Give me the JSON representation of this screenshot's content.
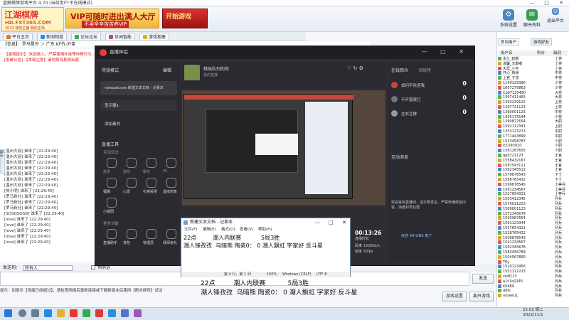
{
  "client": {
    "title": "蓝鲸棋牌游戏平台 4.70 (当前用户:不在线模式)",
    "window_controls": "— □ ✕",
    "logo": {
      "line1": "江湖棋牌",
      "line2": "HD.FXT365.COM",
      "line3": "2013 我的主播 我的主场"
    },
    "vip_banner": {
      "line1": "VIP可随时进出满人大厅",
      "line2": "不用辛辛苦苦养VIP"
    },
    "ad_banner": "开始游戏",
    "top_buttons": [
      {
        "label": "系统设置",
        "icon": "gear-icon"
      },
      {
        "label": "聊天有料",
        "icon": "chat-icon"
      },
      {
        "label": "个人中心",
        "icon": "user-icon"
      },
      {
        "label": "退出平台",
        "icon": "exit-icon"
      }
    ],
    "tabs": [
      "平台主页",
      "新闻频道",
      "论坛论坛",
      "体闲智能",
      "游戏相册"
    ],
    "address": "【信息】：罗马星外 ＞ 广东 KF竹-外佬",
    "chat_lines": [
      {
        "text": "【游戏提示】 欢迎进入，严禁使用外挂等作弊行为……",
        "sys": true
      },
      {
        "text": "[系统公告] 【本局注意】请勿辱骂其他玩家",
        "sys": true
      },
      {
        "text": "[温州大叔] 谁来了 [22:29:40]",
        "sys": false
      },
      {
        "text": "[温州大叔] 谁来了 [22:29:40]",
        "sys": false
      },
      {
        "text": "[温州大叔] 谁来了 [22:29:40]",
        "sys": false
      },
      {
        "text": "[温州大叔] 谁来了 [22:29:40]",
        "sys": false
      },
      {
        "text": "[温州大叔] 谁来了 [22:29:40]",
        "sys": false
      },
      {
        "text": "[温州大叔] 谁来了 [22:29:40]",
        "sys": false
      },
      {
        "text": "[温州大叔] 谁来了 [22:29:40]",
        "sys": false
      },
      {
        "text": "[陈小明] 谁来了 [22:29:40]",
        "sys": false
      },
      {
        "text": "[罗马新社] 谁来了 [22:29:40]",
        "sys": false
      },
      {
        "text": "[罗马新社] 谁来了 [22:29:40]",
        "sys": false
      },
      {
        "text": "[罗马新社] 谁来了 [22:29:40]",
        "sys": false
      },
      {
        "text": "[SOSOSOSO] 谁来了 [22:29:40]",
        "sys": false
      },
      {
        "text": "[love] 谁来了 [22:29:40]",
        "sys": false
      },
      {
        "text": "[love] 谁来了 [22:29:40]",
        "sys": false
      },
      {
        "text": "[love] 谁来了 [22:29:40]",
        "sys": false
      },
      {
        "text": "[love] 谁来了 [22:29:40]",
        "sys": false
      },
      {
        "text": "[love] 谁来了 [22:29:40]",
        "sys": false
      }
    ],
    "left_edge": "聊天",
    "input_label": "发送到：",
    "input_value": "所有人",
    "checkbox_label": "悄悄话",
    "send_button": "发送",
    "hint_text": "提示：如提示【连接已经超过】，请检查网络后重新连接或下载新版本后使用【断点续传】试试",
    "bottom_buttons": [
      "游戏设置",
      "离开游戏"
    ],
    "right_tabs": [
      "房间用户",
      "游戏好友"
    ],
    "right_header": [
      "用户名",
      "积分",
      "级别"
    ],
    "users": [
      {
        "name": "永久_欧鹏",
        "lvl": "上将"
      },
      {
        "name": "温馨_无聊者",
        "lvl": "上将"
      },
      {
        "name": "天涯_小牛",
        "lvl": "上将"
      },
      {
        "name": "开心_随缘",
        "lvl": "中将"
      },
      {
        "name": "上官_子龙",
        "lvl": "中将"
      },
      {
        "name": "1140129390",
        "lvl": "少将"
      },
      {
        "name": "1007279863",
        "lvl": "少将"
      },
      {
        "name": "Cd07120450",
        "lvl": "大校"
      },
      {
        "name": "1397411465",
        "lvl": "大校"
      },
      {
        "name": "1393229122",
        "lvl": "上校"
      },
      {
        "name": "1397721123",
        "lvl": "上校"
      },
      {
        "name": "1390001123",
        "lvl": "中校"
      },
      {
        "name": "1305175544",
        "lvl": "少校"
      },
      {
        "name": "1390827654",
        "lvl": "大尉"
      },
      {
        "name": "1592112341",
        "lvl": "上尉"
      },
      {
        "name": "1353123213",
        "lvl": "中尉"
      },
      {
        "name": "1771443899",
        "lvl": "中尉"
      },
      {
        "name": "1533458787",
        "lvl": "少尉"
      },
      {
        "name": "lc1093910",
        "lvl": "少尉"
      },
      {
        "name": "1581287655",
        "lvl": "少尉"
      },
      {
        "name": "qq0721123",
        "lvl": "士官"
      },
      {
        "name": "1558432167",
        "lvl": "士官"
      },
      {
        "name": "1597543111",
        "lvl": "士官"
      },
      {
        "name": "1562345512",
        "lvl": "士官"
      },
      {
        "name": "1579876543",
        "lvl": "下士"
      },
      {
        "name": "1588765432",
        "lvl": "下士"
      },
      {
        "name": "1599876545",
        "lvl": "上等兵"
      },
      {
        "name": "1561234567",
        "lvl": "上等兵"
      },
      {
        "name": "1527654321",
        "lvl": "上等兵"
      },
      {
        "name": "1503412345",
        "lvl": "列兵"
      },
      {
        "name": "1570011223",
        "lvl": "列兵"
      },
      {
        "name": "1589001123",
        "lvl": "列兵"
      },
      {
        "name": "1572345678",
        "lvl": "列兵"
      },
      {
        "name": "1530987654",
        "lvl": "列兵"
      },
      {
        "name": "1591123344",
        "lvl": "列兵"
      },
      {
        "name": "1557654321",
        "lvl": "列兵"
      },
      {
        "name": "1528765432",
        "lvl": "列兵"
      },
      {
        "name": "1509876543",
        "lvl": "列兵"
      },
      {
        "name": "1541234567",
        "lvl": "列兵"
      },
      {
        "name": "1562345678",
        "lvl": "列兵"
      },
      {
        "name": "1583456789",
        "lvl": "列兵"
      },
      {
        "name": "1504567890",
        "lvl": "列兵"
      },
      {
        "name": "Tfly",
        "lvl": "列兵"
      },
      {
        "name": "1520123456",
        "lvl": "列兵"
      },
      {
        "name": "1551112223",
        "lvl": "列兵"
      },
      {
        "name": "zsdf123",
        "lvl": "列兵"
      },
      {
        "name": "a1c1q1245",
        "lvl": "列兵"
      },
      {
        "name": "KKKKK",
        "lvl": "列兵"
      },
      {
        "name": "ddlk",
        "lvl": "列兵"
      },
      {
        "name": "noseeu1",
        "lvl": "列兵"
      }
    ]
  },
  "obs": {
    "title": "直播伴侣",
    "window_controls": "— □ ✕",
    "scene_mode": "常规模式",
    "scene_edit": "编辑",
    "sources": [
      {
        "label": "notepad.exe 新建文本文档 - 记事本"
      },
      {
        "label": "显示器1"
      }
    ],
    "add_source": "添加素材",
    "stream_title": "棋局队列的你",
    "stream_sub": "我的直播",
    "room_tab": "直播间",
    "tools_header": "直播工具",
    "interact_header": "互动玩法",
    "tools": [
      "投票",
      "连线",
      "聊天",
      "PK",
      "福袋",
      "心愿",
      "礼物投票",
      "虚拟形象",
      "小组团"
    ],
    "more_header": "更多功能",
    "more": [
      "直播助手",
      "背包",
      "管理员",
      "拜师有礼"
    ],
    "online_tab": "在线观众",
    "rank_tab": "贡献榜",
    "fans": [
      {
        "name": "如何不欢迎我",
        "score": "0",
        "color": "#c9463d"
      },
      {
        "name": "不开窗就打",
        "score": "0",
        "color": "#777777"
      },
      {
        "name": "左右互搏",
        "score": "0",
        "color": "#999999"
      }
    ],
    "message_header": "互动消息",
    "message_note": "欢迎来到直播间，请文明发言，严禁传播低俗内容，违者封号处理",
    "follow_notice": "欢迎 SH-LINK 来了",
    "timer": "00:13:26",
    "timer_label": "直播时长",
    "bitrate": "码率 1920kb/s",
    "fps": "帧率 30fps"
  },
  "notepad": {
    "title": "新建文本文档 - 记事本",
    "menu": [
      "文件(F)",
      "编辑(E)",
      "格式(O)",
      "查看(V)",
      "帮助(H)"
    ],
    "text": "22点         潮人内联赛           5局3胜\n潮人锋孜孜  乌暗熊 陶瓷0： 0 潮人飘虹 字家好 反斗星",
    "status": [
      "第 4 行，第 1 列",
      "100%",
      "Windows (CRLF)",
      "UTF-8"
    ]
  },
  "overlay_text": "22点         潮人内联赛           5局3胜\n潮人锋孜孜  乌暗熊 陶瓷0： 0 潮人飘虹 字家好 反斗星",
  "taskbar": {
    "time": "22:02 周二",
    "date": "2022/11/1"
  }
}
